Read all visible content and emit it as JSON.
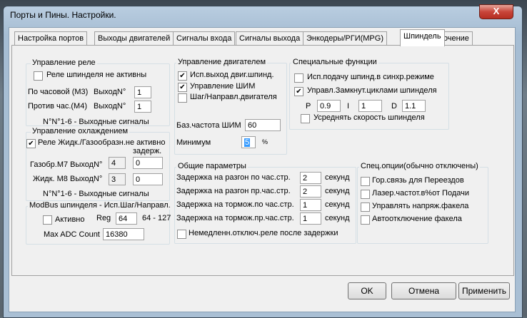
{
  "window": {
    "title": "Порты и Пины.   Настройки.",
    "close": "X"
  },
  "tabs": [
    "Настройка портов",
    "Выходы двигателей",
    "Сигналы входа",
    "Сигналы выхода",
    "Энкодеры/РГИ(MPG)",
    "Шпиндель",
    "Точение"
  ],
  "active_tab": "Шпиндель",
  "relay": {
    "title": "Управление реле",
    "inactive_label": "Реле шпинделя не активны",
    "inactive": false,
    "cw_label": "По часовой (M3)",
    "ccw_label": "Против час.(M4)",
    "out_label": "ВыходN°",
    "cw_value": "1",
    "ccw_value": "1",
    "note": "N°N°1-6 - Выходные сигналы"
  },
  "coolant": {
    "title": "Управление охлаждением",
    "inactive_label": "Реле Жидк./Газообразн.не активно",
    "inactive": true,
    "delay_label": "задерж.",
    "mist_label": "Газобр.M7 ВыходN°",
    "mist_out": "4",
    "mist_delay": "0",
    "flood_label": "Жидк. M8 ВыходN°",
    "flood_out": "3",
    "flood_delay": "0",
    "note": "N°N°1-6 - Выходные сигналы"
  },
  "modbus": {
    "title": "ModBus шпинделя - Исп.Шаг/Направл.",
    "active_label": "Активно",
    "active": false,
    "reg_label": "Reg",
    "reg_value": "64",
    "reg_range": "64 - 127",
    "adc_label": "Max ADC Count",
    "adc_value": "16380"
  },
  "motor": {
    "title": "Управление двигателем",
    "opt1": "Исп.выход двиг.шпинд.",
    "opt1_checked": true,
    "opt2": "Управление ШИМ",
    "opt2_checked": true,
    "opt3": "Шаг/Направл.двигателя",
    "opt3_checked": false,
    "pwm_label": "Баз.частота ШИМ",
    "pwm_value": "60",
    "min_label": "Минимум",
    "min_value": "5",
    "min_unit": "%"
  },
  "special": {
    "title": "Специальные функции",
    "opt1": "Исп.подачу шпинд.в синхр.режиме",
    "opt1_checked": false,
    "opt2": "Управл.Замкнут.циклами шпинделя",
    "opt2_checked": true,
    "p_label": "P",
    "p": "0.9",
    "i_label": "I",
    "i": "1",
    "d_label": "D",
    "d": "1.1",
    "opt3": "Усреднять скорость шпинделя",
    "opt3_checked": false
  },
  "general": {
    "title": "Общие параметры",
    "unit": "секунд",
    "rows": [
      {
        "label": "Задержка на разгон по час.стр.",
        "value": "2"
      },
      {
        "label": "Задержка на разгон пр.час.стр.",
        "value": "2"
      },
      {
        "label": "Задержка на тормож.по час.стр.",
        "value": "1"
      },
      {
        "label": "Задержка на тормож.пр.час.стр.",
        "value": "1"
      }
    ],
    "immediate_label": "Немедленн.отключ.реле после задержки",
    "immediate": false
  },
  "options": {
    "title": "Спец.опции(обычно отключены)",
    "items": [
      {
        "label": "Гор.связь для Переездов",
        "checked": false
      },
      {
        "label": "Лазер.частот.в%от Подачи",
        "checked": false
      },
      {
        "label": "Управлять напряж.факела",
        "checked": false
      },
      {
        "label": "Автоотключение факела",
        "checked": false
      }
    ]
  },
  "buttons": {
    "ok": "OK",
    "cancel": "Отмена",
    "apply": "Применить"
  }
}
